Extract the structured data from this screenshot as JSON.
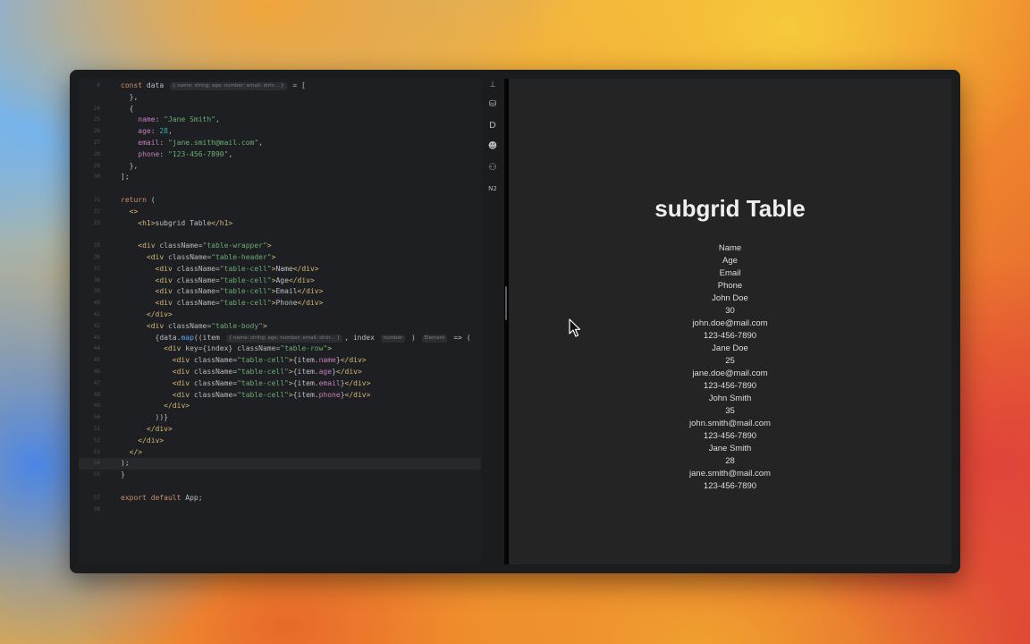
{
  "editor": {
    "lines": [
      {
        "n": "4",
        "html": "<span class=\"kw\">const</span> data <span class=\"hint\">{ name: string; age: number; email: strin… }</span> = ["
      },
      {
        "n": "",
        "html": "  },"
      },
      {
        "n": "24",
        "html": "  {"
      },
      {
        "n": "25",
        "html": "    <span class=\"prop\">name</span>: <span class=\"str\">\"Jane Smith\"</span>,"
      },
      {
        "n": "26",
        "html": "    <span class=\"prop\">age</span>: <span class=\"num\">28</span>,"
      },
      {
        "n": "27",
        "html": "    <span class=\"prop\">email</span>: <span class=\"str\">\"jane.smith@mail.com\"</span>,"
      },
      {
        "n": "28",
        "html": "    <span class=\"prop\">phone</span>: <span class=\"str\">\"123-456-7890\"</span>,"
      },
      {
        "n": "29",
        "html": "  },"
      },
      {
        "n": "30",
        "html": "];"
      },
      {
        "n": "",
        "html": ""
      },
      {
        "n": "31",
        "html": "<span class=\"kw\">return</span> ("
      },
      {
        "n": "32",
        "html": "  <span class=\"tag\">&lt;&gt;</span>"
      },
      {
        "n": "33",
        "html": "    <span class=\"tag\">&lt;h1&gt;</span>subgrid Table<span class=\"tag\">&lt;/h1&gt;</span>"
      },
      {
        "n": "",
        "html": ""
      },
      {
        "n": "35",
        "html": "    <span class=\"tag\">&lt;div</span> <span class=\"attr\">className</span>=<span class=\"str\">\"table-wrapper\"</span><span class=\"tag\">&gt;</span>"
      },
      {
        "n": "36",
        "html": "      <span class=\"tag\">&lt;div</span> <span class=\"attr\">className</span>=<span class=\"str\">\"table-header\"</span><span class=\"tag\">&gt;</span>"
      },
      {
        "n": "37",
        "html": "        <span class=\"tag\">&lt;div</span> <span class=\"attr\">className</span>=<span class=\"str\">\"table-cell\"</span><span class=\"tag\">&gt;</span>Name<span class=\"tag\">&lt;/div&gt;</span>"
      },
      {
        "n": "38",
        "html": "        <span class=\"tag\">&lt;div</span> <span class=\"attr\">className</span>=<span class=\"str\">\"table-cell\"</span><span class=\"tag\">&gt;</span>Age<span class=\"tag\">&lt;/div&gt;</span>"
      },
      {
        "n": "39",
        "html": "        <span class=\"tag\">&lt;div</span> <span class=\"attr\">className</span>=<span class=\"str\">\"table-cell\"</span><span class=\"tag\">&gt;</span>Email<span class=\"tag\">&lt;/div&gt;</span>"
      },
      {
        "n": "40",
        "html": "        <span class=\"tag\">&lt;div</span> <span class=\"attr\">className</span>=<span class=\"str\">\"table-cell\"</span><span class=\"tag\">&gt;</span>Phone<span class=\"tag\">&lt;/div&gt;</span>"
      },
      {
        "n": "41",
        "html": "      <span class=\"tag\">&lt;/div&gt;</span>"
      },
      {
        "n": "42",
        "html": "      <span class=\"tag\">&lt;div</span> <span class=\"attr\">className</span>=<span class=\"str\">\"table-body\"</span><span class=\"tag\">&gt;</span>"
      },
      {
        "n": "43",
        "html": "        {data.<span class=\"fn\">map</span>((item <span class=\"hint\">{ name: string; age: number; email: strin… }</span>, index <span class=\"hint\">number</span> ) <span class=\"hint\">Element</span> =&gt; ("
      },
      {
        "n": "44",
        "html": "          <span class=\"tag\">&lt;div</span> <span class=\"attr\">key</span>={index} <span class=\"attr\">className</span>=<span class=\"str\">\"table-row\"</span><span class=\"tag\">&gt;</span>"
      },
      {
        "n": "45",
        "html": "            <span class=\"tag\">&lt;div</span> <span class=\"attr\">className</span>=<span class=\"str\">\"table-cell\"</span><span class=\"tag\">&gt;</span>{item.<span class=\"prop\">name</span>}<span class=\"tag\">&lt;/div&gt;</span>"
      },
      {
        "n": "46",
        "html": "            <span class=\"tag\">&lt;div</span> <span class=\"attr\">className</span>=<span class=\"str\">\"table-cell\"</span><span class=\"tag\">&gt;</span>{item.<span class=\"prop\">age</span>}<span class=\"tag\">&lt;/div&gt;</span>"
      },
      {
        "n": "47",
        "html": "            <span class=\"tag\">&lt;div</span> <span class=\"attr\">className</span>=<span class=\"str\">\"table-cell\"</span><span class=\"tag\">&gt;</span>{item.<span class=\"prop\">email</span>}<span class=\"tag\">&lt;/div&gt;</span>"
      },
      {
        "n": "48",
        "html": "            <span class=\"tag\">&lt;div</span> <span class=\"attr\">className</span>=<span class=\"str\">\"table-cell\"</span><span class=\"tag\">&gt;</span>{item.<span class=\"prop\">phone</span>}<span class=\"tag\">&lt;/div&gt;</span>"
      },
      {
        "n": "49",
        "html": "          <span class=\"tag\">&lt;/div&gt;</span>"
      },
      {
        "n": "50",
        "html": "        ))}"
      },
      {
        "n": "51",
        "html": "      <span class=\"tag\">&lt;/div&gt;</span>"
      },
      {
        "n": "52",
        "html": "    <span class=\"tag\">&lt;/div&gt;</span>"
      },
      {
        "n": "53",
        "html": "  <span class=\"tag\">&lt;/&gt;</span>"
      },
      {
        "n": "54",
        "html": ");"
      },
      {
        "n": "55",
        "html": "}"
      },
      {
        "n": "",
        "html": ""
      },
      {
        "n": "57",
        "html": "<span class=\"kw\">export default</span> App;"
      },
      {
        "n": "58",
        "html": ""
      }
    ],
    "active_line": "54"
  },
  "toolstrip": {
    "items": [
      {
        "name": "database-icon",
        "glyph": "⛁"
      },
      {
        "name": "d-plugin-icon",
        "glyph": "D"
      },
      {
        "name": "copilot-icon",
        "glyph": "☻"
      },
      {
        "name": "ai-assistant-icon",
        "glyph": "⚇"
      },
      {
        "name": "n2-plugin-icon",
        "glyph": "N2"
      }
    ]
  },
  "preview": {
    "title": "subgrid Table",
    "cells": [
      "Name",
      "Age",
      "Email",
      "Phone",
      "John Doe",
      "30",
      "john.doe@mail.com",
      "123-456-7890",
      "Jane Doe",
      "25",
      "jane.doe@mail.com",
      "123-456-7890",
      "John Smith",
      "35",
      "john.smith@mail.com",
      "123-456-7890",
      "Jane Smith",
      "28",
      "jane.smith@mail.com",
      "123-456-7890"
    ]
  }
}
